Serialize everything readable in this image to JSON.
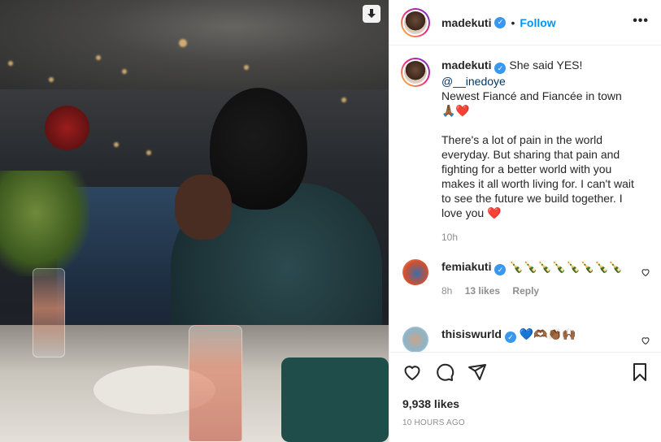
{
  "post": {
    "author": "madekuti",
    "follow_label": "Follow",
    "bullet": "•",
    "more": "•••"
  },
  "caption": {
    "author": "madekuti",
    "line1": "She said YES!",
    "mention": "@__inedoye",
    "line2": "Newest Fiancé and Fiancée in town",
    "line2_emoji": "🙏🏾❤️",
    "para": "There's a lot of pain in the world everyday. But sharing that pain and fighting for a better world with you makes it all worth living for. I can't wait to see the future we build together. I love you",
    "para_emoji": "❤️",
    "time": "10h"
  },
  "comments": [
    {
      "author": "femiakuti",
      "text": "🍾🍾🍾🍾🍾🍾🍾🍾",
      "time": "8h",
      "likes": "13 likes",
      "reply": "Reply"
    },
    {
      "author": "thisiswurld",
      "text": "💙🫶🏾👏🏾🙌🏾"
    }
  ],
  "stats": {
    "likes": "9,938 likes",
    "posted": "10 HOURS AGO"
  },
  "colors": {
    "accent": "#0095f6",
    "verified": "#3897f0",
    "muted": "#8e8e8e"
  },
  "icons": [
    "download-icon",
    "verified-badge-icon",
    "more-options-icon",
    "heart-icon",
    "comment-icon",
    "share-icon",
    "bookmark-icon"
  ]
}
